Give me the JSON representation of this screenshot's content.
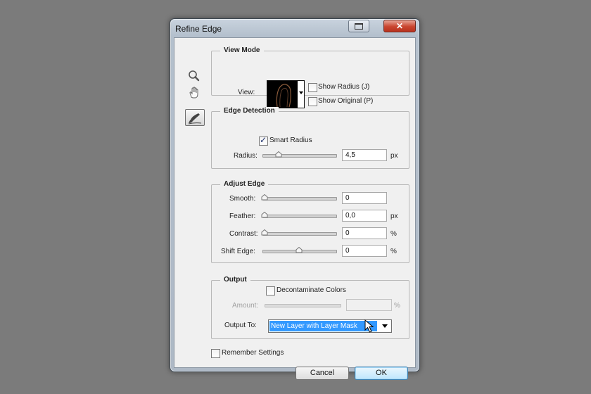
{
  "window": {
    "title": "Refine Edge",
    "restore_icon": "restore-icon",
    "close_glyph": "✕"
  },
  "tools": [
    "zoom-icon",
    "hand-icon",
    "refine-radius-brush-icon"
  ],
  "view_mode": {
    "title": "View Mode",
    "view_label": "View:",
    "show_radius_label": "Show Radius (J)",
    "show_radius_checked": false,
    "show_original_label": "Show Original (P)",
    "show_original_checked": false
  },
  "edge_detection": {
    "title": "Edge Detection",
    "smart_radius_label": "Smart Radius",
    "smart_radius_checked": true,
    "radius_label": "Radius:",
    "radius_value": "4,5",
    "radius_unit": "px",
    "radius_fraction": 0.2
  },
  "adjust_edge": {
    "title": "Adjust Edge",
    "rows": [
      {
        "label": "Smooth:",
        "value": "0",
        "unit": "",
        "fraction": 0.0
      },
      {
        "label": "Feather:",
        "value": "0,0",
        "unit": "px",
        "fraction": 0.0
      },
      {
        "label": "Contrast:",
        "value": "0",
        "unit": "%",
        "fraction": 0.0
      },
      {
        "label": "Shift Edge:",
        "value": "0",
        "unit": "%",
        "fraction": 0.5
      }
    ]
  },
  "output": {
    "title": "Output",
    "decontaminate_label": "Decontaminate Colors",
    "decontaminate_checked": false,
    "amount_label": "Amount:",
    "amount_value": "",
    "amount_unit": "%",
    "output_to_label": "Output To:",
    "output_to_value": "New Layer with Layer Mask"
  },
  "remember_settings_label": "Remember Settings",
  "remember_settings_checked": false,
  "buttons": {
    "cancel": "Cancel",
    "ok": "OK"
  }
}
